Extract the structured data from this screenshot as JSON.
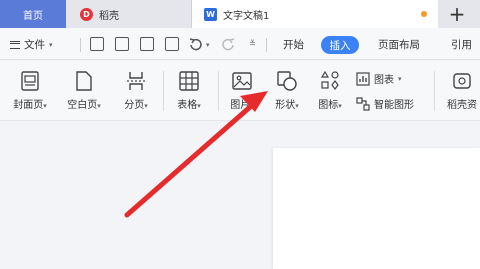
{
  "tabs": {
    "home": "首页",
    "daoke": "稻壳",
    "doc": "文字文稿1"
  },
  "menu": {
    "file": "文件",
    "items": [
      "开始",
      "插入",
      "页面布局",
      "引用"
    ]
  },
  "ribbon": {
    "cover": "封面页",
    "blank": "空白页",
    "pagebreak": "分页",
    "table": "表格",
    "picture": "图片",
    "shape": "形状",
    "icon": "图标",
    "chart": "图表",
    "smartart": "智能图形",
    "daoke_res": "稻壳资"
  },
  "colors": {
    "accent": "#3b82f6",
    "home_tab": "#5b7bd9",
    "arrow": "#e52b2b"
  }
}
